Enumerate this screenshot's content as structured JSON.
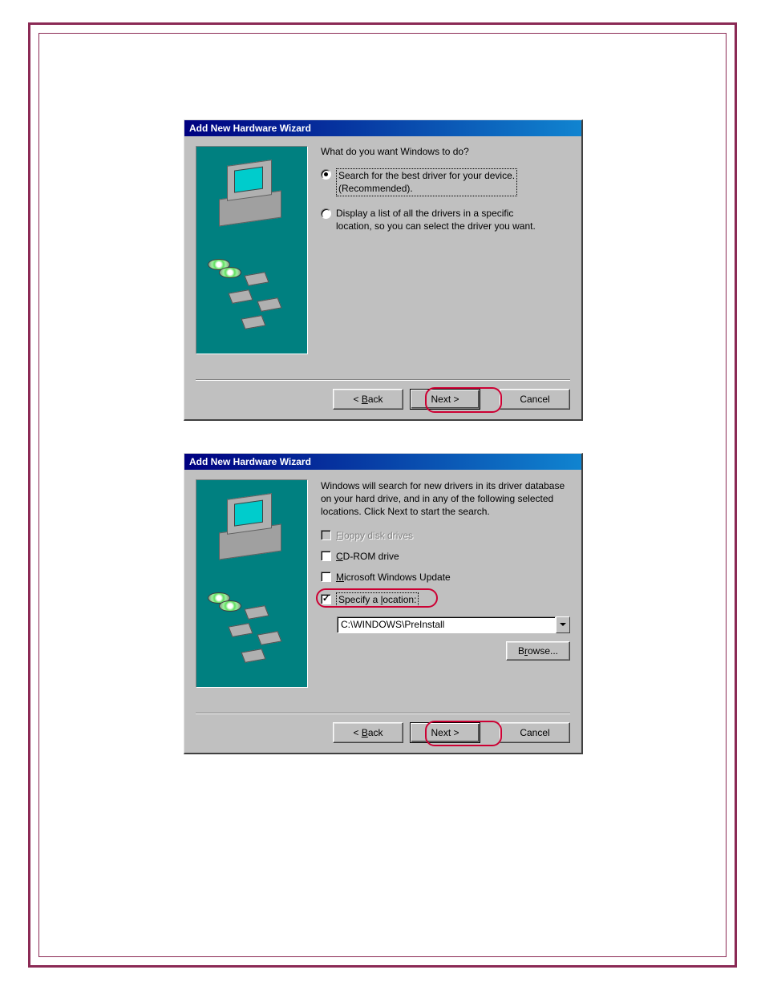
{
  "dialog1": {
    "title": "Add New Hardware Wizard",
    "prompt": "What do you want Windows to do?",
    "radios": [
      {
        "label_line1": "Search for the best driver for your device.",
        "label_line2": "(Recommended).",
        "checked": true
      },
      {
        "label_line1": "Display a list of all the drivers in a specific",
        "label_line2": "location, so you can select the driver you want.",
        "checked": false
      }
    ],
    "buttons": {
      "back": "< Back",
      "next": "Next >",
      "cancel": "Cancel"
    }
  },
  "dialog2": {
    "title": "Add New Hardware Wizard",
    "prompt": "Windows will search for new drivers in its driver database on your hard drive, and in any of the following selected locations. Click Next to start the search.",
    "checkboxes": [
      {
        "label": "Floppy disk drives",
        "checked": false,
        "disabled": true,
        "accel": "F"
      },
      {
        "label": "CD-ROM drive",
        "checked": false,
        "disabled": false,
        "accel": "C"
      },
      {
        "label": "Microsoft Windows Update",
        "checked": false,
        "disabled": false,
        "accel": "M"
      },
      {
        "label": "Specify a location:",
        "checked": true,
        "disabled": false,
        "accel": "l"
      }
    ],
    "location_value": "C:\\WINDOWS\\PreInstall",
    "browse_label": "Browse...",
    "buttons": {
      "back": "< Back",
      "next": "Next >",
      "cancel": "Cancel"
    }
  }
}
